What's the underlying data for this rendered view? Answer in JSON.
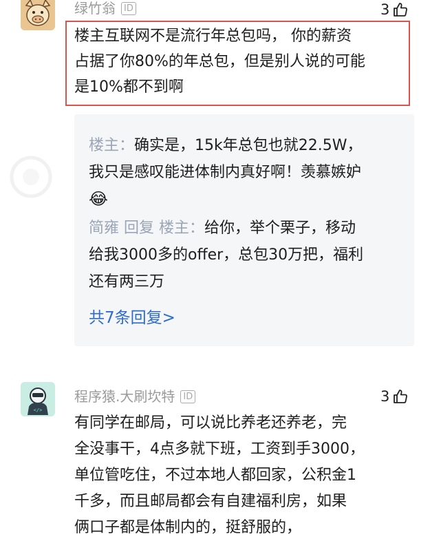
{
  "comments": [
    {
      "username": "绿竹翁",
      "id_badge": "ID",
      "likes": "3",
      "text_lines": [
        "楼主互联网不是流行年总包吗， 你的薪资",
        "占据了你80%的年总包，但是别人说的可能",
        "是10%都不到啊"
      ],
      "replies": [
        {
          "author": "楼主",
          "sep": "：",
          "lines": [
            "确实是，15k年总包也就22.5W，",
            "我只是感叹能进体制内真好啊！羡慕嫉妒"
          ],
          "emoji": "😂"
        },
        {
          "author": "简雍 回复 楼主",
          "sep": "：",
          "lines": [
            "给你，举个栗子，移动",
            "给我3000多的offer，总包30万把，福利",
            "还有两三万"
          ]
        }
      ],
      "more_replies": "共7条回复>"
    },
    {
      "username": "程序猿.大刷坎特",
      "id_badge": "ID",
      "likes": "3",
      "avatar_code": "</>",
      "text_lines": [
        "有同学在邮局，可以说比养老还养老，完",
        "全没事干，4点多就下班，工资到手3000，",
        "单位管吃住，不过本地人都回家，公积金1",
        "千多，而且邮局都会有自建福利房，如果",
        "俩口子都是体制内的，挺舒服的，"
      ]
    }
  ],
  "icons": {
    "like": "thumbs-up-icon"
  },
  "colors": {
    "highlight": "#d9534f",
    "link": "#2e6bd0",
    "reply_author": "#9aa5b5"
  }
}
